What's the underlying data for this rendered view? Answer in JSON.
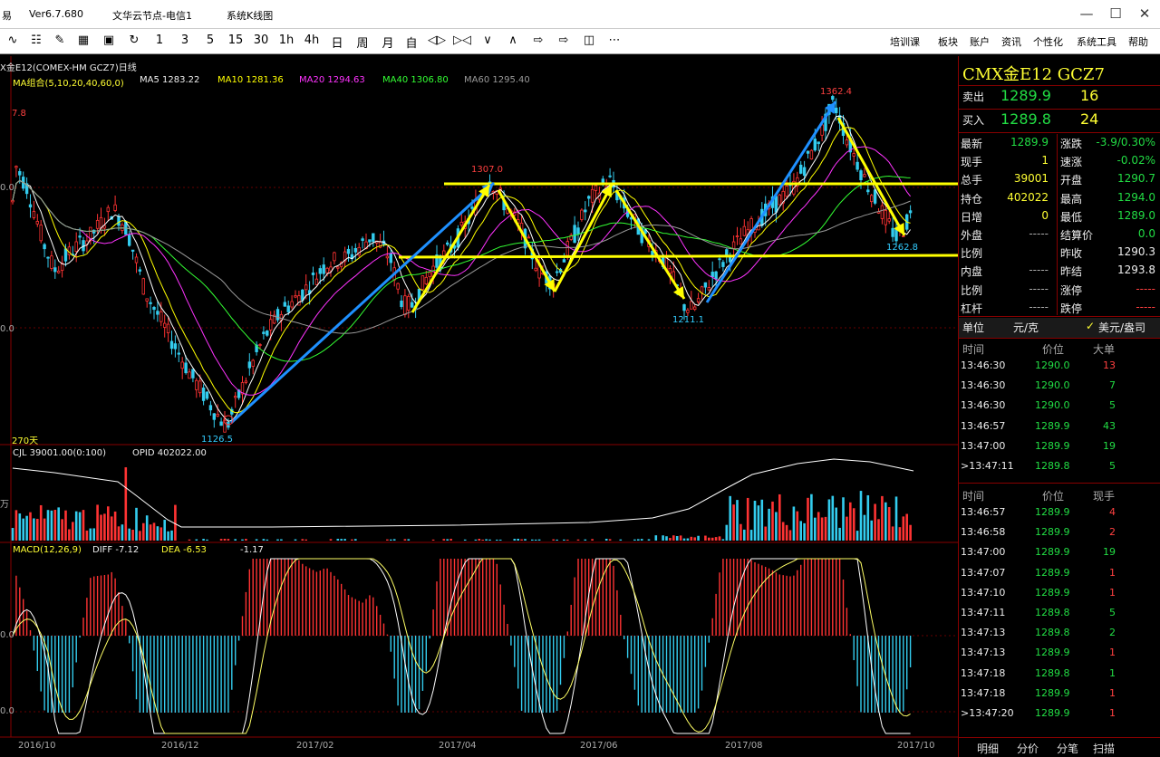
{
  "window": {
    "app_name": "易",
    "version": "Ver6.7.680",
    "node": "文华云节点-电信1",
    "menu_sys": "系统K线图"
  },
  "toolbar": {
    "periods": [
      "1",
      "3",
      "5",
      "15",
      "30",
      "1h",
      "4h",
      "日",
      "周",
      "月",
      "自"
    ],
    "menus": [
      "培训课",
      "板块",
      "账户",
      "资讯",
      "个性化",
      "系统工具",
      "帮助"
    ]
  },
  "chart_header": {
    "instrument": "X金E12(COMEX-HM GCZ7)日线",
    "ma_group": "MA组合(5,10,20,40,60,0)",
    "ma5": "MA5 1283.22",
    "ma10": "MA10 1281.36",
    "ma20": "MA20 1294.63",
    "ma40": "MA40 1306.80",
    "ma60": "MA60 1295.40",
    "left_top_value": "7.8",
    "days": "270天"
  },
  "price_labels": {
    "high_1362": "1362.4",
    "high_1307": "1307.0",
    "low_1262": "1262.8",
    "low_1211": "1211.1",
    "low_1126": "1126.5"
  },
  "axis_left": {
    "p1": "0.0",
    "p2": "0.0",
    "vol_unit": "万",
    "macd_zero": "0.0",
    "macd_low": "0.0"
  },
  "volume_header": {
    "cjl": "CJL  39001.00(0:100)",
    "opid": "OPID  402022.00"
  },
  "macd_header": {
    "name": "MACD(12,26,9)",
    "diff": "DIFF  -7.12",
    "dea": "DEA  -6.53",
    "macd": "-1.17"
  },
  "x_axis": [
    "2016/10",
    "2016/12",
    "2017/02",
    "2017/04",
    "2017/06",
    "2017/08",
    "2017/10"
  ],
  "panel": {
    "title": "CMX金E12  GCZ7",
    "ask_label": "卖出",
    "ask_price": "1289.9",
    "ask_vol": "16",
    "bid_label": "买入",
    "bid_price": "1289.8",
    "bid_vol": "24",
    "stats": [
      {
        "l1": "最新",
        "v1": "1289.9",
        "c1": "green",
        "l2": "涨跌",
        "v2": "-3.9/0.30%",
        "c2": "green"
      },
      {
        "l1": "现手",
        "v1": "1",
        "c1": "yellow",
        "l2": "速涨",
        "v2": "-0.02%",
        "c2": "green"
      },
      {
        "l1": "总手",
        "v1": "39001",
        "c1": "yellow",
        "l2": "开盘",
        "v2": "1290.7",
        "c2": "green"
      },
      {
        "l1": "持仓",
        "v1": "402022",
        "c1": "yellow",
        "l2": "最高",
        "v2": "1294.0",
        "c2": "green"
      },
      {
        "l1": "日增",
        "v1": "0",
        "c1": "yellow",
        "l2": "最低",
        "v2": "1289.0",
        "c2": "green"
      },
      {
        "l1": "外盘",
        "v1": "-----",
        "c1": "gray",
        "l2": "结算价",
        "v2": "0.0",
        "c2": "green"
      },
      {
        "l1": "比例",
        "v1": "",
        "c1": "gray",
        "l2": "昨收",
        "v2": "1290.3",
        "c2": "white"
      },
      {
        "l1": "内盘",
        "v1": "-----",
        "c1": "gray",
        "l2": "昨结",
        "v2": "1293.8",
        "c2": "white"
      },
      {
        "l1": "比例",
        "v1": "-----",
        "c1": "gray",
        "l2": "涨停",
        "v2": "-----",
        "c2": "red"
      },
      {
        "l1": "杠杆",
        "v1": "-----",
        "c1": "gray",
        "l2": "跌停",
        "v2": "-----",
        "c2": "red"
      }
    ],
    "unit_label": "单位",
    "unit_a": "元/克",
    "unit_b": "美元/盎司",
    "t1_headers": [
      "时间",
      "价位",
      "大单"
    ],
    "t1_rows": [
      {
        "time": "13:46:30",
        "price": "1290.0",
        "vol": "13",
        "vc": "red"
      },
      {
        "time": "13:46:30",
        "price": "1290.0",
        "vol": "7",
        "vc": "green"
      },
      {
        "time": "13:46:30",
        "price": "1290.0",
        "vol": "5",
        "vc": "green"
      },
      {
        "time": "13:46:57",
        "price": "1289.9",
        "vol": "43",
        "vc": "green"
      },
      {
        "time": "13:47:00",
        "price": "1289.9",
        "vol": "19",
        "vc": "green"
      },
      {
        "time": ">13:47:11",
        "price": "1289.8",
        "vol": "5",
        "vc": "green"
      }
    ],
    "t2_headers": [
      "时间",
      "价位",
      "现手"
    ],
    "t2_rows": [
      {
        "time": "13:46:57",
        "price": "1289.9",
        "vol": "4",
        "vc": "red"
      },
      {
        "time": "13:46:58",
        "price": "1289.9",
        "vol": "2",
        "vc": "red"
      },
      {
        "time": "13:47:00",
        "price": "1289.9",
        "vol": "19",
        "vc": "green"
      },
      {
        "time": "13:47:07",
        "price": "1289.9",
        "vol": "1",
        "vc": "red"
      },
      {
        "time": "13:47:10",
        "price": "1289.9",
        "vol": "1",
        "vc": "red"
      },
      {
        "time": "13:47:11",
        "price": "1289.8",
        "vol": "5",
        "vc": "green"
      },
      {
        "time": "13:47:13",
        "price": "1289.8",
        "vol": "2",
        "vc": "green"
      },
      {
        "time": "13:47:13",
        "price": "1289.9",
        "vol": "1",
        "vc": "red"
      },
      {
        "time": "13:47:18",
        "price": "1289.8",
        "vol": "1",
        "vc": "green"
      },
      {
        "time": "13:47:18",
        "price": "1289.9",
        "vol": "1",
        "vc": "red"
      },
      {
        "time": ">13:47:20",
        "price": "1289.9",
        "vol": "1",
        "vc": "red"
      }
    ],
    "tabs": [
      "明细",
      "分价",
      "分笔",
      "扫描"
    ]
  },
  "colors": {
    "up": "#ff3333",
    "down": "#33ccee",
    "ma5": "#ffffff",
    "ma10": "#ffff00",
    "ma20": "#ff33ff",
    "ma40": "#33ff33",
    "ma60": "#999999",
    "trend_blue": "#1e90ff",
    "trend_yellow": "#ffff00"
  },
  "chart_data": {
    "type": "line",
    "x_range": [
      "2016/10",
      "2017/10"
    ],
    "price_series_pivots": [
      {
        "label": "start",
        "value": 1317.8
      },
      {
        "label": "low",
        "value": 1126.5
      },
      {
        "label": "high",
        "value": 1307.0
      },
      {
        "label": "low",
        "value": 1211.1
      },
      {
        "label": "high",
        "value": 1362.4
      },
      {
        "label": "low",
        "value": 1262.8
      },
      {
        "label": "last",
        "value": 1289.9
      }
    ],
    "ma": {
      "MA5": 1283.22,
      "MA10": 1281.36,
      "MA20": 1294.63,
      "MA40": 1306.8,
      "MA60": 1295.4
    },
    "volume": {
      "CJL": 39001.0,
      "OPID": 402022.0
    },
    "macd": {
      "DIFF": -7.12,
      "DEA": -6.53,
      "MACD": -1.17
    }
  }
}
